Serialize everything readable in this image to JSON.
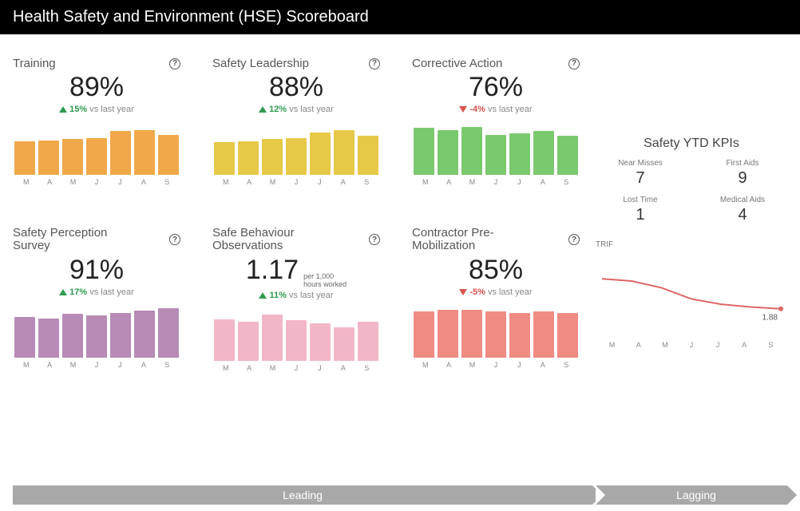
{
  "header": {
    "title": "Health Safety and Environment (HSE) Scoreboard"
  },
  "cards": [
    {
      "id": "training",
      "title": "Training",
      "value": "89%",
      "delta": "15%",
      "delta_dir": "up",
      "vs": "vs last year",
      "color": "#f0a84a",
      "bars": [
        60,
        62,
        64,
        66,
        78,
        80,
        72
      ],
      "labels": [
        "M",
        "A",
        "M",
        "J",
        "J",
        "A",
        "S"
      ]
    },
    {
      "id": "safety-leadership",
      "title": "Safety Leadership",
      "value": "88%",
      "delta": "12%",
      "delta_dir": "up",
      "vs": "vs last year",
      "color": "#e7c948",
      "bars": [
        58,
        60,
        64,
        66,
        76,
        80,
        70
      ],
      "labels": [
        "M",
        "A",
        "M",
        "J",
        "J",
        "A",
        "S"
      ]
    },
    {
      "id": "corrective-action",
      "title": "Corrective Action",
      "value": "76%",
      "delta": "-4%",
      "delta_dir": "down",
      "vs": "vs last year",
      "color": "#7bc96f",
      "bars": [
        84,
        80,
        86,
        72,
        74,
        78,
        70
      ],
      "labels": [
        "M",
        "A",
        "M",
        "J",
        "J",
        "A",
        "S"
      ]
    },
    {
      "id": "safety-perception",
      "title": "Safety Perception",
      "subtitle": "Survey",
      "value": "91%",
      "delta": "17%",
      "delta_dir": "up",
      "vs": "vs last year",
      "color": "#b78bb5",
      "bars": [
        72,
        70,
        78,
        76,
        80,
        84,
        88
      ],
      "labels": [
        "M",
        "A",
        "M",
        "J",
        "J",
        "A",
        "S"
      ]
    },
    {
      "id": "safe-behaviour",
      "title": "Safe Behaviour",
      "subtitle": "Observations",
      "value": "1.17",
      "unit_note": "per 1,000\nhours worked",
      "delta": "11%",
      "delta_dir": "up",
      "vs": "vs last year",
      "color": "#f2b7c6",
      "bars": [
        74,
        70,
        82,
        72,
        66,
        60,
        70
      ],
      "labels": [
        "M",
        "A",
        "M",
        "J",
        "J",
        "A",
        "S"
      ]
    },
    {
      "id": "contractor-premob",
      "title": "Contractor Pre-",
      "subtitle": "Mobilization",
      "value": "85%",
      "delta": "-5%",
      "delta_dir": "down",
      "vs": "vs last year",
      "color": "#f08b84",
      "bars": [
        82,
        86,
        86,
        82,
        80,
        82,
        80
      ],
      "labels": [
        "M",
        "A",
        "M",
        "J",
        "J",
        "A",
        "S"
      ]
    }
  ],
  "kpi_panel": {
    "title": "Safety YTD KPIs",
    "items": [
      {
        "label": "Near Misses",
        "value": "7"
      },
      {
        "label": "First Aids",
        "value": "9"
      },
      {
        "label": "Lost Time",
        "value": "1"
      },
      {
        "label": "Medical Aids",
        "value": "4"
      }
    ],
    "trif": {
      "label": "TRIF",
      "values": [
        2.55,
        2.5,
        2.35,
        2.1,
        1.98,
        1.92,
        1.88
      ],
      "last_label": "1.88",
      "labels": [
        "M",
        "A",
        "M",
        "J",
        "J",
        "A",
        "S"
      ],
      "color": "#e06666"
    }
  },
  "footer": {
    "leading": "Leading",
    "lagging": "Lagging"
  },
  "chart_data": [
    {
      "type": "bar",
      "title": "Training",
      "categories": [
        "M",
        "A",
        "M",
        "J",
        "J",
        "A",
        "S"
      ],
      "values": [
        60,
        62,
        64,
        66,
        78,
        80,
        72
      ],
      "ylim": [
        0,
        100
      ]
    },
    {
      "type": "bar",
      "title": "Safety Leadership",
      "categories": [
        "M",
        "A",
        "M",
        "J",
        "J",
        "A",
        "S"
      ],
      "values": [
        58,
        60,
        64,
        66,
        76,
        80,
        70
      ],
      "ylim": [
        0,
        100
      ]
    },
    {
      "type": "bar",
      "title": "Corrective Action",
      "categories": [
        "M",
        "A",
        "M",
        "J",
        "J",
        "A",
        "S"
      ],
      "values": [
        84,
        80,
        86,
        72,
        74,
        78,
        70
      ],
      "ylim": [
        0,
        100
      ]
    },
    {
      "type": "bar",
      "title": "Safety Perception Survey",
      "categories": [
        "M",
        "A",
        "M",
        "J",
        "J",
        "A",
        "S"
      ],
      "values": [
        72,
        70,
        78,
        76,
        80,
        84,
        88
      ],
      "ylim": [
        0,
        100
      ]
    },
    {
      "type": "bar",
      "title": "Safe Behaviour Observations",
      "categories": [
        "M",
        "A",
        "M",
        "J",
        "J",
        "A",
        "S"
      ],
      "values": [
        74,
        70,
        82,
        72,
        66,
        60,
        70
      ],
      "ylabel": "per 1,000 hours worked",
      "ylim": [
        0,
        100
      ]
    },
    {
      "type": "bar",
      "title": "Contractor Pre-Mobilization",
      "categories": [
        "M",
        "A",
        "M",
        "J",
        "J",
        "A",
        "S"
      ],
      "values": [
        82,
        86,
        86,
        82,
        80,
        82,
        80
      ],
      "ylim": [
        0,
        100
      ]
    },
    {
      "type": "line",
      "title": "TRIF",
      "categories": [
        "M",
        "A",
        "M",
        "J",
        "J",
        "A",
        "S"
      ],
      "values": [
        2.55,
        2.5,
        2.35,
        2.1,
        1.98,
        1.92,
        1.88
      ],
      "ylim": [
        1.5,
        3.0
      ]
    }
  ]
}
